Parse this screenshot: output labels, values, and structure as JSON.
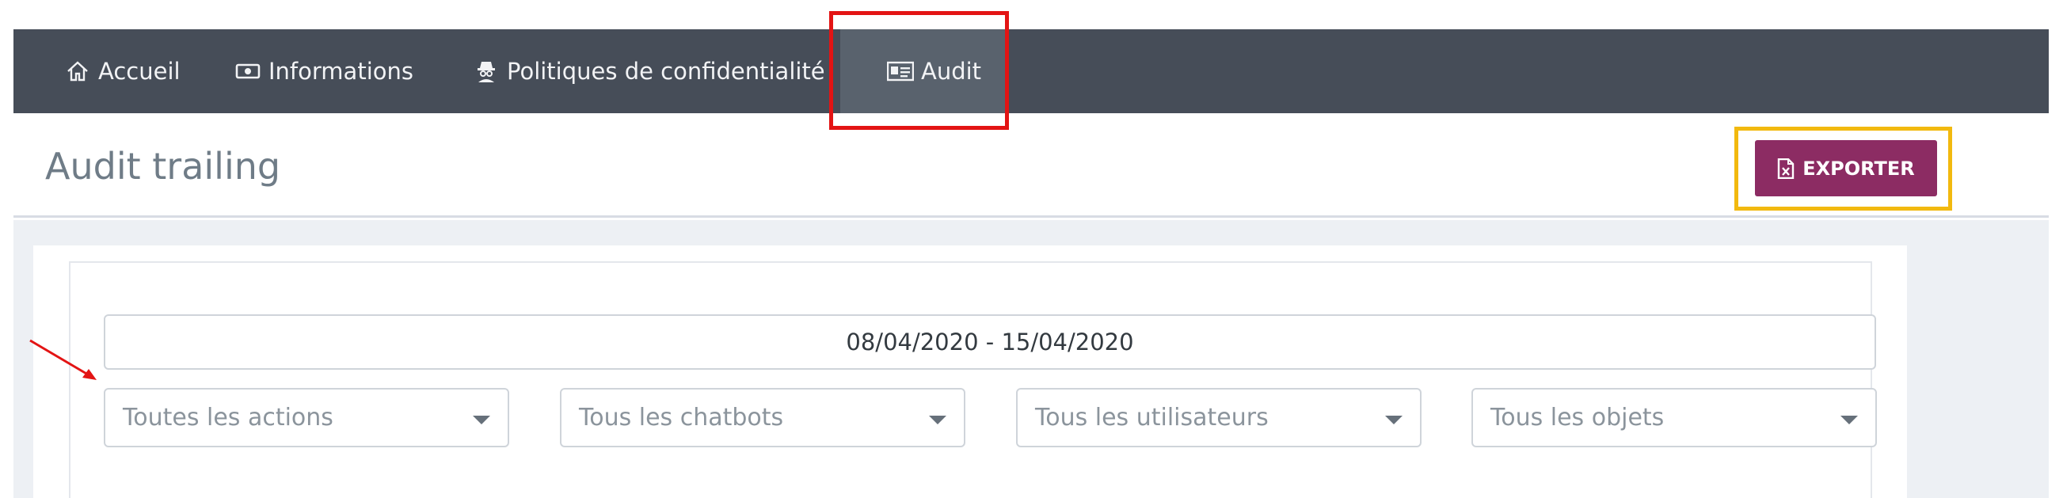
{
  "nav": {
    "items": [
      {
        "label": "Accueil",
        "icon": "home-icon"
      },
      {
        "label": "Informations",
        "icon": "money-icon"
      },
      {
        "label": "Politiques de confidentialité",
        "icon": "spy-icon"
      },
      {
        "label": "Audit",
        "icon": "id-card-icon",
        "active": true
      }
    ]
  },
  "page": {
    "title": "Audit trailing",
    "export_label": "EXPORTER"
  },
  "filters": {
    "date_range": "08/04/2020 - 15/04/2020",
    "actions": "Toutes les actions",
    "chatbots": "Tous les chatbots",
    "users": "Tous les utilisateurs",
    "objects": "Tous les objets"
  },
  "colors": {
    "navbar": "#464d58",
    "nav_active": "#59626d",
    "export_button": "#8c2c63",
    "annotation_red": "#e31414",
    "annotation_yellow": "#f2b90f"
  }
}
